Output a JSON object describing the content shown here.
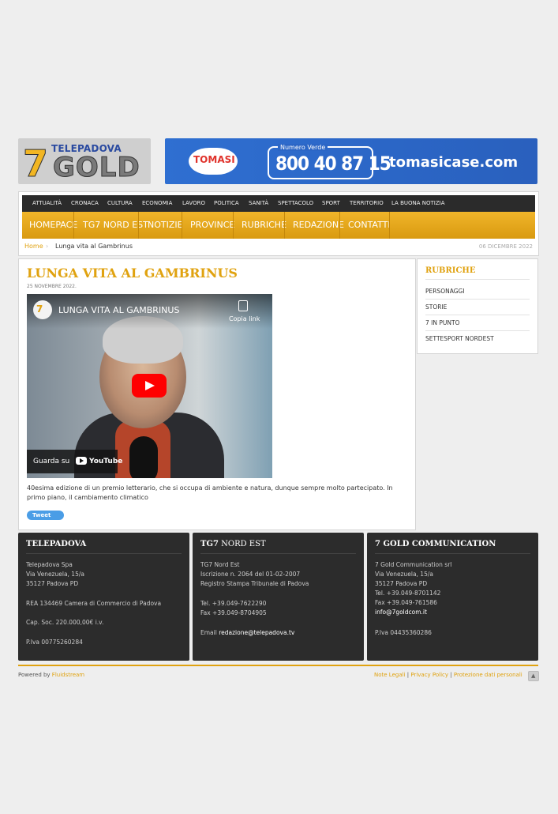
{
  "header": {
    "logo": {
      "seven": "7",
      "line1": "TELEPADOVA",
      "line2": "GOLD"
    },
    "banner": {
      "brand": "TOMASI",
      "numero_verde": "Numero Verde",
      "phone": "800 40 87 15",
      "url": "tomasicase.com"
    }
  },
  "topnav": [
    "ATTUALITÀ",
    "CRONACA",
    "CULTURA",
    "ECONOMIA",
    "LAVORO",
    "POLITICA",
    "SANITÀ",
    "SPETTACOLO",
    "SPORT",
    "TERRITORIO",
    "LA BUONA NOTIZIA"
  ],
  "mainnav": [
    "HOMEPACE",
    "TG7 NORD EST",
    "NOTIZIE",
    "PROVINCE",
    "RUBRICHE",
    "REDAZIONE",
    "CONTATTI"
  ],
  "breadcrumb": {
    "home": "Home",
    "arrow": "›",
    "current": "Lunga vita al Gambrinus",
    "date": "06 DICEMBRE 2022"
  },
  "article": {
    "title": "LUNGA VITA AL GAMBRINUS",
    "date": "25 NOVEMBRE 2022.",
    "video": {
      "channel_glyph": "7",
      "title": "LUNGA VITA AL GAMBRINUS",
      "copy_link": "Copia link",
      "watch_on": "Guarda su",
      "youtube": "YouTube"
    },
    "description": "40esima edizione di un premio letterario, che si occupa di ambiente e natura, dunque sempre molto partecipato. In primo piano, il cambiamento climatico",
    "tweet": "Tweet"
  },
  "sidebar": {
    "title": "RUBRICHE",
    "items": [
      "PERSONAGGI",
      "STORIE",
      "7 IN PUNTO",
      "SETTESPORT NORDEST"
    ]
  },
  "footer": {
    "telepadova": {
      "title": "TELEPADOVA",
      "lines": [
        "Telepadova Spa",
        "Via Venezuela, 15/a",
        "35127 Padova PD",
        "REA 134469 Camera di Commercio di Padova",
        "Cap. Soc. 220.000,00€ i.v.",
        "P.Iva 00775260284"
      ]
    },
    "tg7": {
      "title_strong": "TG7",
      "title_rest": " NORD EST",
      "lines": [
        "TG7 Nord Est",
        "Iscrizione n. 2064 del 01-02-2007",
        "Registro Stampa Tribunale di Padova",
        "Tel. +39.049-7622290",
        "Fax +39.049-8704905"
      ],
      "email_label": "Email ",
      "email": "redazione@telepadova.tv"
    },
    "gold": {
      "title": "7 GOLD COMMUNICATION",
      "lines": [
        "7 Gold Communication srl",
        "Via Venezuela, 15/a",
        "35127 Padova PD",
        "Tel. +39.049-8701142",
        "Fax +39.049-761586"
      ],
      "email": "info@7goldcom.it",
      "piva": "P.Iva 04435360286"
    },
    "powered_prefix": "Powered by ",
    "powered_link": "Fluidstream",
    "legal": [
      "Note Legali",
      "Privacy Policy",
      "Protezione dati personali"
    ],
    "legal_sep": "|",
    "totop_glyph": "▲"
  },
  "colors": {
    "accent": "#e0a20f",
    "dark": "#2c2c2c",
    "topnav": "#2b2b2b"
  }
}
